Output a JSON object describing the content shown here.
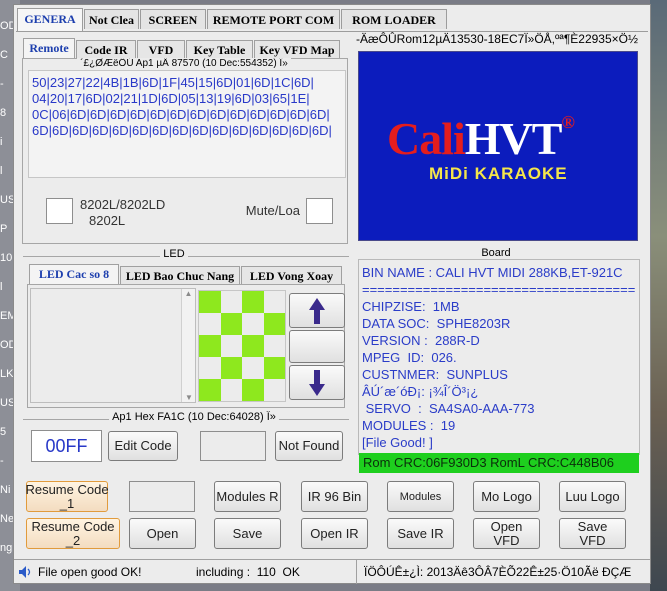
{
  "tabs": [
    "GENERA",
    "Not Clea",
    "SCREEN",
    "REMOTE PORT COM",
    "ROM LOADER"
  ],
  "subtabs": [
    "Remote",
    "Code IR",
    "VFD",
    "Key Table",
    "Key VFD Map"
  ],
  "rom_title": "-ÄæÔÛRom12µÄ13530-18EC7Ï»ÖÅ,ºª¶È22935×Ö½",
  "remote_group_label": "´£¿ØÆëÔÚ Ap1 µÄ 87570 (10 Dec:554352) Î»",
  "hex_lines": [
    "50|23|27|22|4B|1B|6D|1F|45|15|6D|01|6D|1C|6D|",
    "04|20|17|6D|02|21|1D|6D|05|13|19|6D|03|65|1E|",
    "0C|06|6D|6D|6D|6D|6D|6D|6D|6D|6D|6D|6D|6D|6D|",
    "6D|6D|6D|6D|6D|6D|6D|6D|6D|6D|6D|6D|6D|6D|6D|"
  ],
  "chip_label_1": "8202L/8202LD",
  "chip_label_2": "8202L",
  "mute_label": "Mute/Loa",
  "logo": {
    "cali": "Cali",
    "hvt": "HVT",
    "reg": "®",
    "sub": "MiDi KARAOKE"
  },
  "led_label": "LED",
  "led_tabs": [
    "LED Cac so 8",
    "LED Bao Chuc Nang",
    "LED Vong Xoay"
  ],
  "board_label": "Board",
  "board_lines": [
    "BIN NAME : CALI HVT MIDI 288KB,ET-921C",
    "====================================",
    "CHIPZISE:  1MB",
    "DATA SOC:  SPHE8203R",
    "VERSION :  288R-D",
    "MPEG  ID:  026.",
    "CUSTNMER:  SUNPLUS",
    "ÂÚ´æ´óÐ¡: ¡¾Î´Ö³¡¿",
    " SERVO  :  SA4SA0-AAA-773",
    "MODULES :  19",
    "[File Good! ]"
  ],
  "crc_text": "Rom CRC:06F930D3 RomL CRC:C448B06",
  "ap1_label": "Ap1  Hex   FA1C (10 Dec:64028) Î»",
  "hex_value": "00FF",
  "edit_code": "Edit Code",
  "not_found": "Not Found",
  "buttons_row1": [
    "Resume Code\n_1",
    "",
    "Modules R",
    "IR 96 Bin",
    "Modules",
    "Mo Logo",
    "Luu Logo"
  ],
  "buttons_row2": [
    "Resume Code\n_2",
    "Open",
    "Save",
    "Open IR",
    "Save IR",
    "Open\nVFD",
    "Save\nVFD"
  ],
  "status_left": "File open good OK!",
  "status_mid": "including :  110  OK",
  "status_right": "ÏÖÔÚÊ±¿Ì: 2013Äê3ÔÂ7ÈÕ22Ê±25·Ö10Ãë ÐÇÆ",
  "desktop_glyphs": [
    "OD",
    "C",
    "-",
    "8",
    "i",
    "l",
    "US",
    "P",
    "10",
    "l",
    "EM",
    "OD",
    "LK",
    "US",
    "5",
    "-",
    "Ni",
    "Ne",
    "ngi"
  ]
}
